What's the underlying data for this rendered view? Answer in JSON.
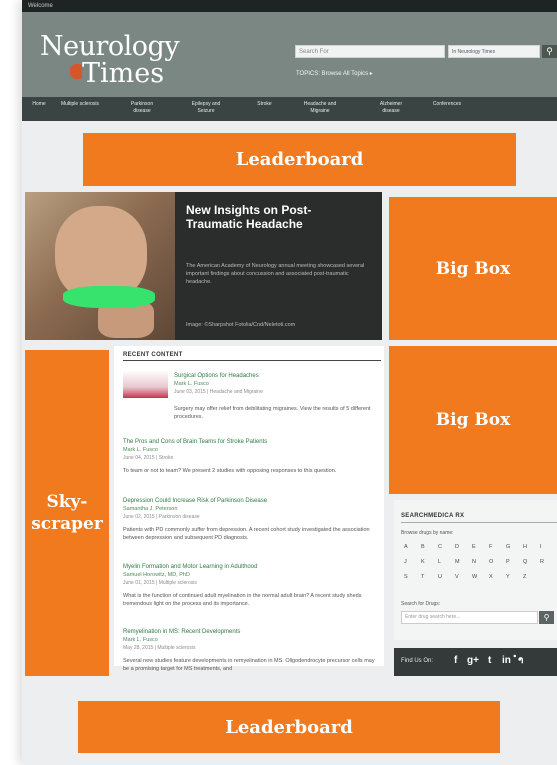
{
  "topbar": {
    "text": "Welcome"
  },
  "site": {
    "name_line1": "Neurology",
    "name_line2": "Times"
  },
  "search": {
    "placeholder": "Search For",
    "scope": "In Neurology Times",
    "button_icon": "search-icon"
  },
  "header": {
    "topics_label": "TOPICS: Browse All Topics ▸"
  },
  "nav": {
    "items": [
      "Home",
      "Multiple sclerosis",
      "Parkinson disease",
      "Epilepsy and Seizure",
      "Stroke",
      "Headache and Migraine",
      "Alzheimer disease",
      "Conferences"
    ]
  },
  "ads": {
    "leaderboard_top": "Leaderboard",
    "big_box_1": "Big Box",
    "big_box_2": "Big Box",
    "skyscraper": "Sky-\nscraper",
    "leaderboard_bottom": "Leaderboard",
    "color": "#f07a1d"
  },
  "hero": {
    "title": "New Insights on Post-Traumatic Headache",
    "body": "The American Academy of Neurology annual meeting showcased several important findings about concussion and associated post-traumatic headache.",
    "credit": "Image: ©Sharpshot Fotolia/Cnd/Neletoti.com"
  },
  "recent": {
    "heading": "RECENT CONTENT",
    "items": [
      {
        "title": "Surgical Options for Headaches",
        "author": "Mark L. Fusco",
        "meta": "June 03, 2015  |  Headache and Migraine",
        "body": "Surgery may offer relief from debilitating migraines. View the results of 5 different procedures."
      },
      {
        "title": "The Pros and Cons of Brain Teams for Stroke Patients",
        "author": "Mark L. Fusco",
        "meta": "June 04, 2015  |  Stroke",
        "body": "To team or not to team? We present 2 studies with opposing responses to this question."
      },
      {
        "title": "Depression Could Increase Risk of Parkinson Disease",
        "author": "Samantha J. Peterson",
        "meta": "June 02, 2015  |  Parkinson disease",
        "body": "Patients with PD commonly suffer from depression. A recent cohort study investigated the association between depression and subsequent PD diagnosis."
      },
      {
        "title": "Myelin Formation and Motor Learning in Adulthood",
        "author": "Samuel Horowitz, MD, PhD",
        "meta": "June 01, 2015  |  Multiple sclerosis",
        "body": "What is the function of continued adult myelination in the normal adult brain? A recent study sheds tremendous light on the process and its importance."
      },
      {
        "title": "Remyelination in MS: Recent Developments",
        "author": "Mark L. Fusco",
        "meta": "May 28, 2015  |  Multiple sclerosis",
        "body": "Several new studies feature developments in remyelination in MS. Oligodendrocyte precursor cells may be a promising target for MS treatments, and"
      }
    ]
  },
  "rx": {
    "heading": "SEARCHMEDICA RX",
    "browse_label": "Browse drugs by name:",
    "letters": [
      "A",
      "B",
      "C",
      "D",
      "E",
      "F",
      "G",
      "H",
      "I",
      "J",
      "K",
      "L",
      "M",
      "N",
      "O",
      "P",
      "Q",
      "R",
      "S",
      "T",
      "U",
      "V",
      "W",
      "X",
      "Y",
      "Z"
    ],
    "search_label": "Search for Drugs:",
    "search_placeholder": "Enter drug search here..."
  },
  "social": {
    "label": "Find Us On:",
    "icons": [
      "facebook-icon",
      "google-plus-icon",
      "twitter-icon",
      "linkedin-icon",
      "rss-icon"
    ],
    "glyphs": [
      "f",
      "g+",
      "t",
      "in",
      "ຳ"
    ]
  }
}
